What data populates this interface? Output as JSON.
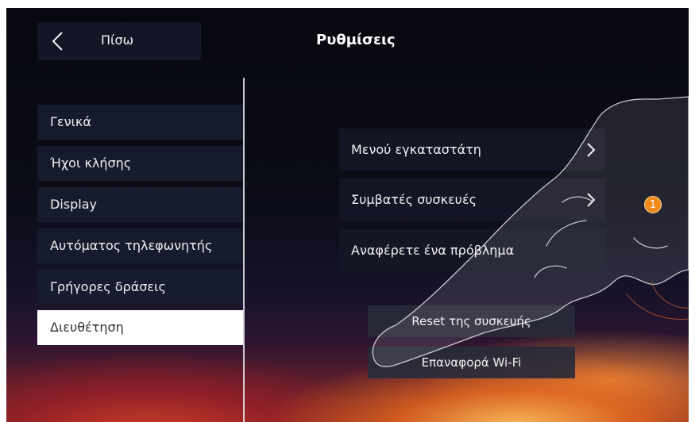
{
  "header": {
    "back_label": "Πίσω",
    "title": "Ρυθμίσεις"
  },
  "sidebar": {
    "items": [
      {
        "label": "Γενικά",
        "active": false
      },
      {
        "label": "Ήχοι κλήσης",
        "active": false
      },
      {
        "label": "Display",
        "active": false
      },
      {
        "label": "Αυτόματος τηλεφωνητής",
        "active": false
      },
      {
        "label": "Γρήγορες δράσεις",
        "active": false
      },
      {
        "label": "Διευθέτηση",
        "active": true
      }
    ]
  },
  "main": {
    "options": [
      {
        "label": "Μενού εγκαταστάτη",
        "icon": "chevron-right-icon"
      },
      {
        "label": "Συμβατές συσκευές",
        "icon": "chevron-right-icon"
      },
      {
        "label": "Αναφέρετε ένα πρόβλημα"
      }
    ],
    "actions": [
      {
        "label": "Reset της συσκευής"
      },
      {
        "label": "Επαναφορά Wi-Fi"
      }
    ]
  },
  "annotation": {
    "step_number": "1",
    "color": "#f08a1c"
  },
  "colors": {
    "panel": "#131626",
    "active_bg": "#ffffff",
    "active_text": "#303030",
    "divider": "#ebebf0"
  }
}
